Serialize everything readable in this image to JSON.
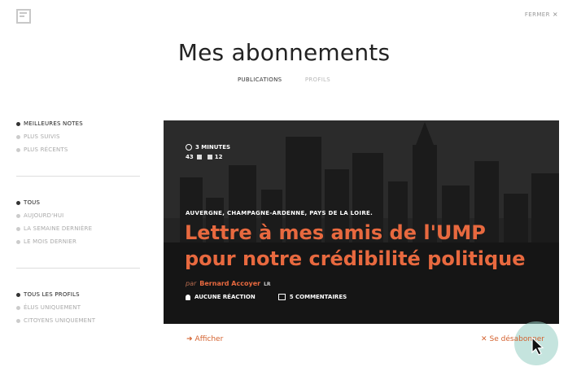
{
  "header": {
    "close_label": "FERMER",
    "close_icon": "×",
    "title": "Mes abonnements"
  },
  "tabs": [
    {
      "label": "PUBLICATIONS",
      "active": true
    },
    {
      "label": "PROFILS",
      "active": false
    }
  ],
  "filters": {
    "sort": [
      {
        "label": "MEILLEURES NOTES",
        "selected": true
      },
      {
        "label": "PLUS SUIVIS",
        "selected": false
      },
      {
        "label": "PLUS RÉCENTS",
        "selected": false
      }
    ],
    "period": [
      {
        "label": "TOUS",
        "selected": true
      },
      {
        "label": "AUJOURD'HUI",
        "selected": false
      },
      {
        "label": "LA SEMAINE DERNIÈRE",
        "selected": false
      },
      {
        "label": "LE MOIS DERNIER",
        "selected": false
      }
    ],
    "profiles": [
      {
        "label": "TOUS LES PROFILS",
        "selected": true
      },
      {
        "label": "ÉLUS UNIQUEMENT",
        "selected": false
      },
      {
        "label": "CITOYENS UNIQUEMENT",
        "selected": false
      }
    ]
  },
  "card": {
    "reading_time": "3 MINUTES",
    "up_count": "43",
    "down_count": "12",
    "regions": "AUVERGNE, CHAMPAGNE-ARDENNE, PAYS DE LA LOIRE.",
    "headline": "Lettre à mes amis de l'UMP pour notre crédibilité politique",
    "by": "par",
    "author": "Bernard Accoyer",
    "party": "LR",
    "reactions": "AUCUNE RÉACTION",
    "comments": "5 COMMENTAIRES"
  },
  "actions": {
    "show_label": "Afficher",
    "unsubscribe_label": "Se désabonner"
  },
  "colors": {
    "accent": "#e8693f",
    "cursor_halo": "#96cdc3"
  }
}
